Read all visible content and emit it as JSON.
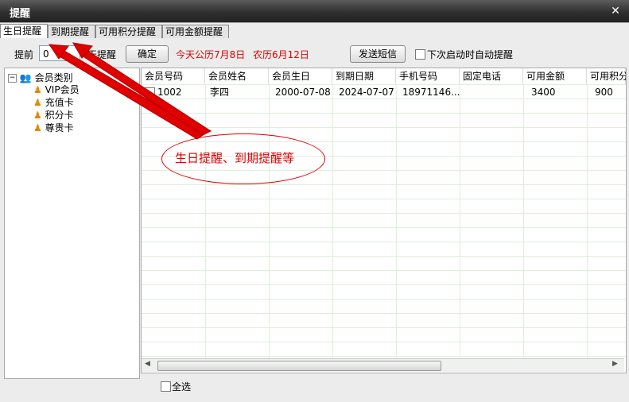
{
  "window": {
    "title": "提醒"
  },
  "tabs": [
    "生日提醒",
    "到期提醒",
    "可用积分提醒",
    "可用金额提醒"
  ],
  "toolbar": {
    "days_before_label": "提前",
    "days_value": "0",
    "days_after_label": "天提醒",
    "confirm_label": "确定",
    "today_text": "今天公历7月8日",
    "lunar_text": "农历6月12日",
    "send_sms_label": "发送短信",
    "auto_remind_label": "下次启动时自动提醒"
  },
  "tree": {
    "root": "会员类别",
    "items": [
      "VIP会员",
      "充值卡",
      "积分卡",
      "尊贵卡"
    ]
  },
  "grid": {
    "columns": [
      "会员号码",
      "会员姓名",
      "会员生日",
      "到期日期",
      "手机号码",
      "固定电话",
      "可用金额",
      "可用积分"
    ],
    "rows": [
      [
        "1002",
        "李四",
        "2000-07-08",
        "2024-07-07",
        "18971146...",
        "",
        "3400",
        "900"
      ]
    ]
  },
  "footer": {
    "select_all_label": "全选"
  },
  "annotation": {
    "text": "生日提醒、到期提醒等"
  },
  "colors": {
    "annotation": "#e00000",
    "titlebar": "#2f2f2f"
  }
}
